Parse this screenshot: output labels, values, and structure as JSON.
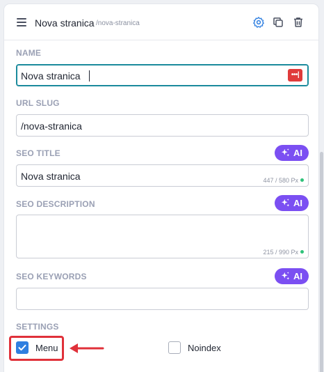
{
  "header": {
    "title": "Nova stranica",
    "slug": "/nova-stranica"
  },
  "fields": {
    "name": {
      "label": "NAME",
      "value": "Nova stranica"
    },
    "url_slug": {
      "label": "URL SLUG",
      "value": "/nova-stranica"
    },
    "seo_title": {
      "label": "SEO TITLE",
      "value": "Nova stranica",
      "counter": "447 / 580 Px"
    },
    "seo_description": {
      "label": "SEO DESCRIPTION",
      "value": "",
      "counter": "215 / 990 Px"
    },
    "seo_keywords": {
      "label": "SEO KEYWORDS",
      "value": ""
    }
  },
  "ai_button_label": "AI",
  "password_button_glyph": "•••|",
  "settings": {
    "label": "SETTINGS",
    "menu": {
      "label": "Menu",
      "checked": true
    },
    "noindex": {
      "label": "Noindex",
      "checked": false
    }
  },
  "colors": {
    "accent_purple": "#7b4ff2",
    "checkbox_blue": "#2f7fe0",
    "highlight_red": "#e0313a",
    "focus_teal": "#1a8a9c",
    "status_green": "#2fc27a"
  },
  "icons": [
    "hamburger-icon",
    "gear-icon",
    "duplicate-icon",
    "trash-icon",
    "password-icon",
    "sparkle-icon",
    "check-icon",
    "arrow-left-icon"
  ]
}
